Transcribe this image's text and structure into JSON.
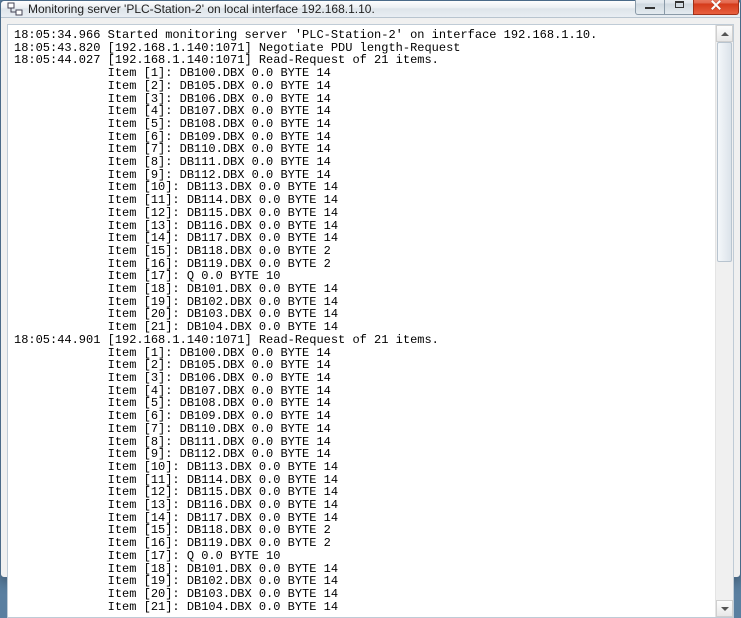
{
  "titlebar": {
    "title": "Monitoring server 'PLC-Station-2' on local interface 192.168.1.10."
  },
  "log": {
    "lines": [
      "18:05:34.966 Started monitoring server 'PLC-Station-2' on interface 192.168.1.10.",
      "18:05:43.820 [192.168.1.140:1071] Negotiate PDU length-Request",
      "18:05:44.027 [192.168.1.140:1071] Read-Request of 21 items.",
      "             Item [1]: DB100.DBX 0.0 BYTE 14",
      "             Item [2]: DB105.DBX 0.0 BYTE 14",
      "             Item [3]: DB106.DBX 0.0 BYTE 14",
      "             Item [4]: DB107.DBX 0.0 BYTE 14",
      "             Item [5]: DB108.DBX 0.0 BYTE 14",
      "             Item [6]: DB109.DBX 0.0 BYTE 14",
      "             Item [7]: DB110.DBX 0.0 BYTE 14",
      "             Item [8]: DB111.DBX 0.0 BYTE 14",
      "             Item [9]: DB112.DBX 0.0 BYTE 14",
      "             Item [10]: DB113.DBX 0.0 BYTE 14",
      "             Item [11]: DB114.DBX 0.0 BYTE 14",
      "             Item [12]: DB115.DBX 0.0 BYTE 14",
      "             Item [13]: DB116.DBX 0.0 BYTE 14",
      "             Item [14]: DB117.DBX 0.0 BYTE 14",
      "             Item [15]: DB118.DBX 0.0 BYTE 2",
      "             Item [16]: DB119.DBX 0.0 BYTE 2",
      "             Item [17]: Q 0.0 BYTE 10",
      "             Item [18]: DB101.DBX 0.0 BYTE 14",
      "             Item [19]: DB102.DBX 0.0 BYTE 14",
      "             Item [20]: DB103.DBX 0.0 BYTE 14",
      "             Item [21]: DB104.DBX 0.0 BYTE 14",
      "18:05:44.901 [192.168.1.140:1071] Read-Request of 21 items.",
      "             Item [1]: DB100.DBX 0.0 BYTE 14",
      "             Item [2]: DB105.DBX 0.0 BYTE 14",
      "             Item [3]: DB106.DBX 0.0 BYTE 14",
      "             Item [4]: DB107.DBX 0.0 BYTE 14",
      "             Item [5]: DB108.DBX 0.0 BYTE 14",
      "             Item [6]: DB109.DBX 0.0 BYTE 14",
      "             Item [7]: DB110.DBX 0.0 BYTE 14",
      "             Item [8]: DB111.DBX 0.0 BYTE 14",
      "             Item [9]: DB112.DBX 0.0 BYTE 14",
      "             Item [10]: DB113.DBX 0.0 BYTE 14",
      "             Item [11]: DB114.DBX 0.0 BYTE 14",
      "             Item [12]: DB115.DBX 0.0 BYTE 14",
      "             Item [13]: DB116.DBX 0.0 BYTE 14",
      "             Item [14]: DB117.DBX 0.0 BYTE 14",
      "             Item [15]: DB118.DBX 0.0 BYTE 2",
      "             Item [16]: DB119.DBX 0.0 BYTE 2",
      "             Item [17]: Q 0.0 BYTE 10",
      "             Item [18]: DB101.DBX 0.0 BYTE 14",
      "             Item [19]: DB102.DBX 0.0 BYTE 14",
      "             Item [20]: DB103.DBX 0.0 BYTE 14",
      "             Item [21]: DB104.DBX 0.0 BYTE 14"
    ]
  }
}
